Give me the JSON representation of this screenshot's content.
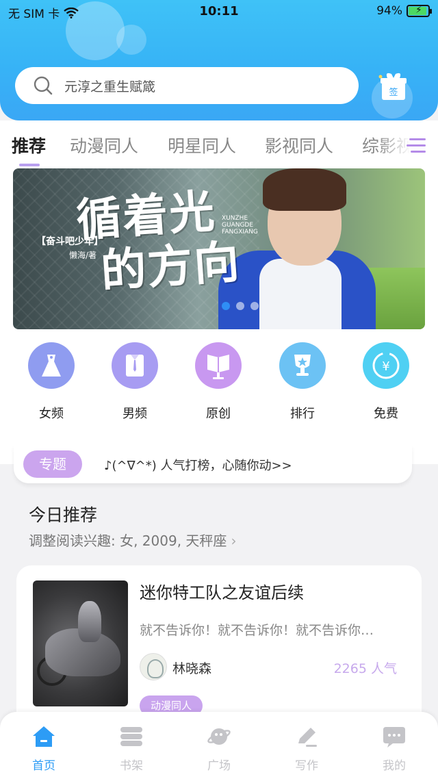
{
  "status_bar": {
    "carrier": "无 SIM 卡",
    "time": "10:11",
    "battery": "94%"
  },
  "header": {
    "search_placeholder": "元淳之重生赋箴",
    "signin_label": "签"
  },
  "tabs": [
    {
      "label": "推荐",
      "active": true
    },
    {
      "label": "动漫同人",
      "active": false
    },
    {
      "label": "明星同人",
      "active": false
    },
    {
      "label": "影视同人",
      "active": false
    },
    {
      "label": "综影视",
      "active": false
    }
  ],
  "banner": {
    "title_line1": "循着光",
    "title_line2": "的方向",
    "subtitle": "【奋斗吧少年】",
    "author": "懒海/著",
    "pinyin": "XUNZHE GUANGDE FANGXIANG",
    "dots": 3,
    "active_dot": 0
  },
  "categories": [
    {
      "label": "女频",
      "icon": "dress-icon",
      "color": "#8f9cf0"
    },
    {
      "label": "男频",
      "icon": "shirt-icon",
      "color": "#a79cf2"
    },
    {
      "label": "原创",
      "icon": "book-stand-icon",
      "color": "#c898f0"
    },
    {
      "label": "排行",
      "icon": "trophy-icon",
      "color": "#6cc2f4"
    },
    {
      "label": "免费",
      "icon": "yen-coin-icon",
      "color": "#4fd0f3"
    }
  ],
  "topic": {
    "badge": "专题",
    "text": "♪(^∇^*) 人气打榜，心随你动>>"
  },
  "today": {
    "title": "今日推荐",
    "subtitle": "调整阅读兴趣: 女, 2009, 天秤座"
  },
  "book": {
    "title": "迷你特工队之友谊后续",
    "description": "就不告诉你！就不告诉你！就不告诉你…",
    "author": "林晓森",
    "popularity": "2265 人气",
    "tag": "动漫同人"
  },
  "bottom_nav": [
    {
      "label": "首页",
      "icon": "home-icon",
      "active": true
    },
    {
      "label": "书架",
      "icon": "bookshelf-icon",
      "active": false
    },
    {
      "label": "广场",
      "icon": "planet-icon",
      "active": false
    },
    {
      "label": "写作",
      "icon": "pen-icon",
      "active": false
    },
    {
      "label": "我的",
      "icon": "chat-bubble-icon",
      "active": false
    }
  ],
  "colors": {
    "header_blue": "#3fb6f6",
    "accent_purple": "#c9a4ee",
    "nav_active": "#2d9cf5"
  }
}
